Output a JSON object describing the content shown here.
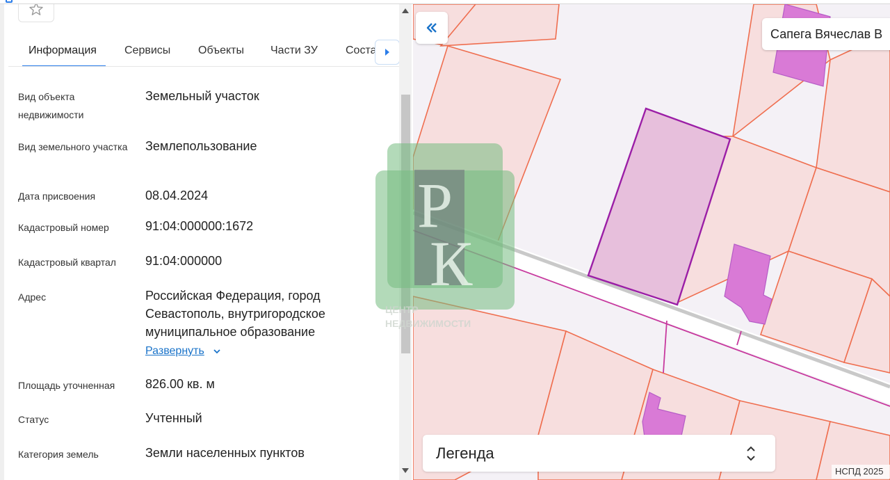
{
  "tabs": {
    "info": "Информация",
    "services": "Сервисы",
    "objects": "Объекты",
    "parts": "Части ЗУ",
    "composition": "Состав"
  },
  "details": {
    "object_type": {
      "label": "Вид объекта недвижимости",
      "value": "Земельный участок"
    },
    "land_type": {
      "label": "Вид земельного участка",
      "value": "Землепользование"
    },
    "assigned_date": {
      "label": "Дата присвоения",
      "value": "08.04.2024"
    },
    "cadastral_number": {
      "label": "Кадастровый номер",
      "value": "91:04:000000:1672"
    },
    "cadastral_quarter": {
      "label": "Кадастровый квартал",
      "value": "91:04:000000"
    },
    "address": {
      "label": "Адрес",
      "value": "Российская Федерация, город Севастополь, внутригородское муниципальное образование"
    },
    "expand_link": "Развернуть",
    "area": {
      "label": "Площадь уточненная",
      "value": "826.00 кв. м"
    },
    "status": {
      "label": "Статус",
      "value": "Учтенный"
    },
    "land_category": {
      "label": "Категория земель",
      "value": "Земли населенных пунктов"
    }
  },
  "map": {
    "owner": "Сапега Вячеслав В",
    "legend": "Легенда",
    "attribution": "НСПД 2025"
  },
  "watermark": {
    "line1": "ЦЕНТР",
    "line2": "НЕДВИЖИМОСТИ",
    "letters_top": "Р",
    "letters_bottom": "К"
  },
  "colors": {
    "accent": "#2b7de9",
    "link": "#1a73c9",
    "parcel_fill": "#f7dede",
    "parcel_border": "#ef6e4f",
    "selected_border": "#9b1ea6",
    "building_fill": "#d97ad6"
  },
  "icons": {
    "favorite": "star-icon",
    "tab_next": "chevron-right-icon",
    "collapse": "double-chevron-left-icon",
    "legend_toggle": "updown-chevron-icon",
    "expand": "chevron-down-icon"
  }
}
